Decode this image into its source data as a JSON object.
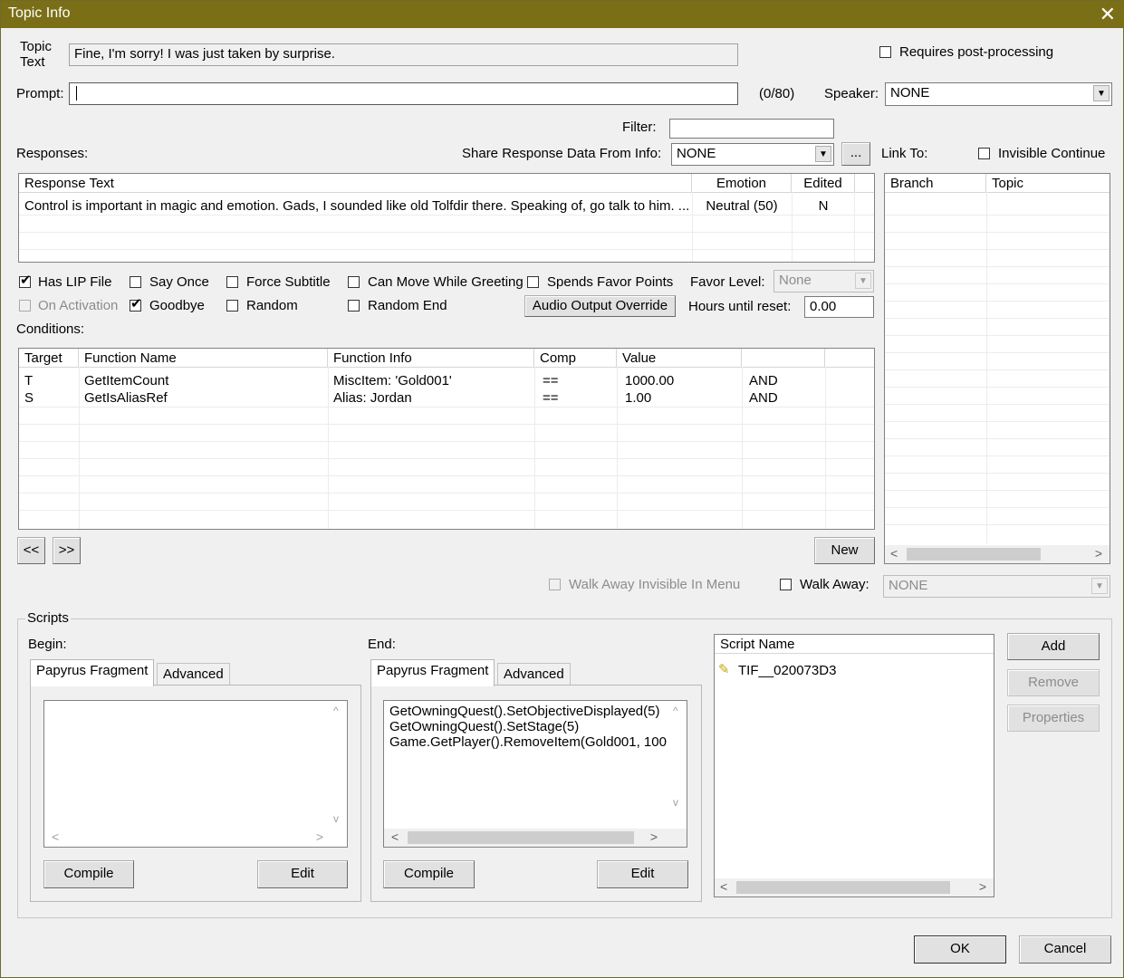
{
  "window": {
    "title": "Topic Info",
    "close_glyph": "✕"
  },
  "topic": {
    "label_line1": "Topic",
    "label_line2": "Text",
    "value": "Fine, I'm sorry! I was just taken by surprise."
  },
  "requires_post_processing": {
    "label": "Requires post-processing",
    "checked": false
  },
  "prompt": {
    "label": "Prompt:",
    "value": "",
    "counter": "(0/80)"
  },
  "speaker": {
    "label": "Speaker:",
    "value": "NONE"
  },
  "filter": {
    "label": "Filter:",
    "value": ""
  },
  "responses": {
    "label": "Responses:",
    "share_label": "Share Response Data From Info:",
    "share_value": "NONE",
    "ellipsis_button": "...",
    "columns": [
      "Response Text",
      "Emotion",
      "Edited"
    ],
    "rows": [
      {
        "text": "Control is important in magic and emotion. Gads, I sounded like old Tolfdir there. Speaking of, go talk to him. ...",
        "emotion": "Neutral (50)",
        "edited": "N"
      }
    ]
  },
  "link_to": {
    "label": "Link To:",
    "invisible_continue": {
      "label": "Invisible Continue",
      "checked": false
    },
    "columns": [
      "Branch",
      "Topic"
    ]
  },
  "flags": {
    "has_lip_file": {
      "label": "Has LIP File",
      "checked": true
    },
    "say_once": {
      "label": "Say Once",
      "checked": false
    },
    "force_subtitle": {
      "label": "Force Subtitle",
      "checked": false
    },
    "can_move_while_greeting": {
      "label": "Can Move While Greeting",
      "checked": false
    },
    "spends_favor_points": {
      "label": "Spends Favor Points",
      "checked": false
    },
    "on_activation": {
      "label": "On Activation",
      "checked": false
    },
    "goodbye": {
      "label": "Goodbye",
      "checked": true
    },
    "random": {
      "label": "Random",
      "checked": false
    },
    "random_end": {
      "label": "Random End",
      "checked": false
    },
    "check_glyph": "✔"
  },
  "favor_level": {
    "label": "Favor Level:",
    "value": "None"
  },
  "audio_output_override": "Audio Output Override",
  "hours_until_reset": {
    "label": "Hours until reset:",
    "value": "0.00"
  },
  "conditions": {
    "label": "Conditions:",
    "columns": [
      "Target",
      "Function Name",
      "Function Info",
      "Comp",
      "Value",
      ""
    ],
    "rows": [
      {
        "target": "T",
        "function": "GetItemCount",
        "info": "MiscItem: 'Gold001'",
        "comp": "==",
        "value": "1000.00",
        "op": "AND"
      },
      {
        "target": "S",
        "function": "GetIsAliasRef",
        "info": "Alias: Jordan",
        "comp": "==",
        "value": "1.00",
        "op": "AND"
      }
    ],
    "prev_button": "<<",
    "next_button": ">>",
    "new_button": "New"
  },
  "walk_away": {
    "invisible_in_menu": {
      "label": "Walk Away Invisible In Menu",
      "checked": false
    },
    "label": "Walk Away:",
    "checked": false,
    "value": "NONE"
  },
  "scripts": {
    "group_title": "Scripts",
    "begin": {
      "label": "Begin:",
      "tabs": [
        "Papyrus Fragment",
        "Advanced"
      ],
      "code": "",
      "compile": "Compile",
      "edit": "Edit"
    },
    "end": {
      "label": "End:",
      "tabs": [
        "Papyrus Fragment",
        "Advanced"
      ],
      "code": "GetOwningQuest().SetObjectiveDisplayed(5)\nGetOwningQuest().SetStage(5)\nGame.GetPlayer().RemoveItem(Gold001, 100",
      "compile": "Compile",
      "edit": "Edit"
    },
    "list": {
      "column": "Script Name",
      "items": [
        "TIF__020073D3"
      ]
    },
    "add": "Add",
    "remove": "Remove",
    "properties": "Properties"
  },
  "ok_button": "OK",
  "cancel_button": "Cancel"
}
